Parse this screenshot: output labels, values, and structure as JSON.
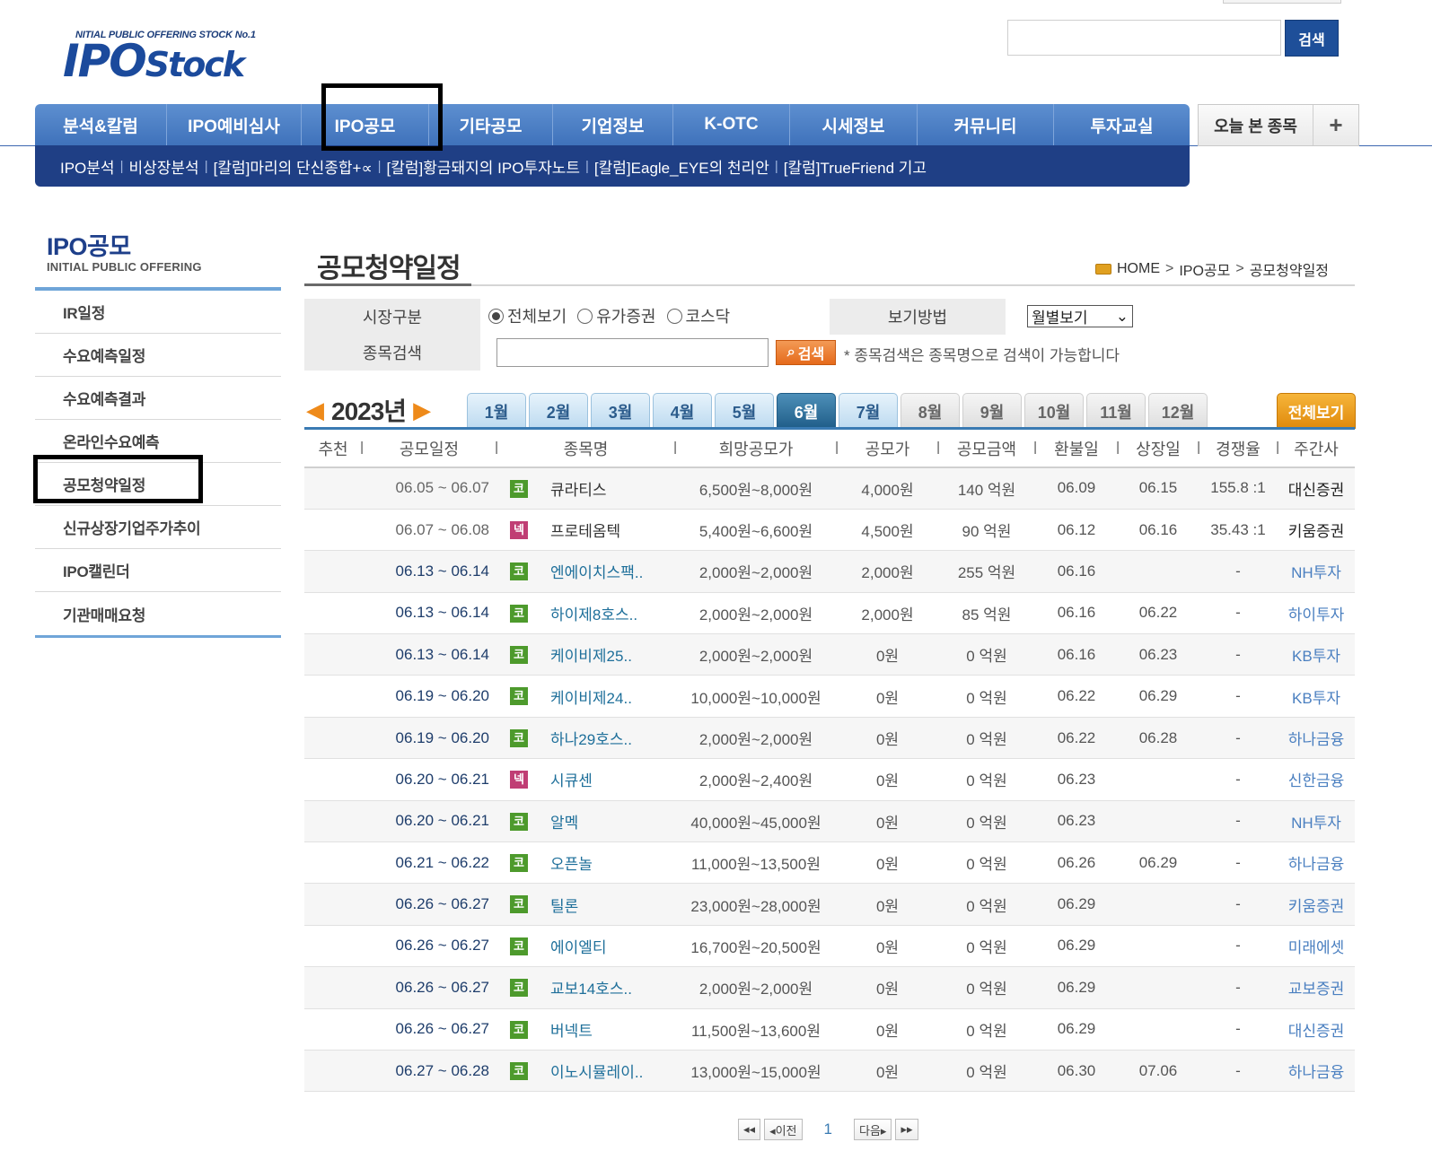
{
  "header": {
    "slogan": "NITIAL PUBLIC OFFERING STOCK No.1",
    "logo_main": "IPO",
    "logo_small": "Stock",
    "search_placeholder": "",
    "search_button": "검색"
  },
  "gnb": {
    "main": [
      "분석&칼럼",
      "IPO예비심사",
      "IPO공모",
      "기타공모",
      "기업정보",
      "K-OTC",
      "시세정보",
      "커뮤니티",
      "투자교실"
    ],
    "sub": [
      "IPO분석",
      "비상장분석",
      "[칼럼]마리의 단신종합+∝",
      "[칼럼]황금돼지의 IPO투자노트",
      "[칼럼]Eagle_EYE의 천리안",
      "[칼럼]TrueFriend 기고"
    ],
    "today_label": "오늘 본 종목",
    "plus_icon": "+"
  },
  "lnb": {
    "title": "IPO공모",
    "subtitle": "INITIAL PUBLIC OFFERING",
    "items": [
      "IR일정",
      "수요예측일정",
      "수요예측결과",
      "온라인수요예측",
      "공모청약일정",
      "신규상장기업주가추이",
      "IPO캘린더",
      "기관매매요청"
    ]
  },
  "content": {
    "title": "공모청약일정",
    "breadcrumb": [
      "HOME",
      "IPO공모",
      "공모청약일정"
    ]
  },
  "filter": {
    "market_label": "시장구분",
    "market_options": [
      "전체보기",
      "유가증권",
      "코스닥"
    ],
    "market_selected": "전체보기",
    "view_label": "보기방법",
    "view_value": "월별보기",
    "stock_label": "종목검색",
    "stock_value": "",
    "stock_button": "검색",
    "note": "* 종목검색은 종목명으로 검색이 가능합니다"
  },
  "calendar": {
    "year": "2023년",
    "months": [
      "1월",
      "2월",
      "3월",
      "4월",
      "5월",
      "6월",
      "7월",
      "8월",
      "9월",
      "10월",
      "11월",
      "12월"
    ],
    "active_month": "6월",
    "all_button": "전체보기"
  },
  "table": {
    "headers": [
      "추천",
      "공모일정",
      "종목명",
      "희망공모가",
      "공모가",
      "공모금액",
      "환불일",
      "상장일",
      "경쟁율",
      "주간사"
    ],
    "rows": [
      {
        "date": "06.05 ~ 06.07",
        "mark": "코",
        "name": "큐라티스",
        "hope": "6,500원~8,000원",
        "price": "4,000원",
        "amount": "140 억원",
        "refund": "06.09",
        "listing": "06.15",
        "rate": "155.8 :1",
        "lead": "대신증권"
      },
      {
        "date": "06.07 ~ 06.08",
        "mark": "넥",
        "name": "프로테옴텍",
        "hope": "5,400원~6,600원",
        "price": "4,500원",
        "amount": "90 억원",
        "refund": "06.12",
        "listing": "06.16",
        "rate": "35.43 :1",
        "lead": "키움증권"
      },
      {
        "date": "06.13 ~ 06.14",
        "mark": "코",
        "name": "엔에이치스팩..",
        "hope": "2,000원~2,000원",
        "price": "2,000원",
        "amount": "255 억원",
        "refund": "06.16",
        "listing": "",
        "rate": "-",
        "lead": "NH투자"
      },
      {
        "date": "06.13 ~ 06.14",
        "mark": "코",
        "name": "하이제8호스..",
        "hope": "2,000원~2,000원",
        "price": "2,000원",
        "amount": "85 억원",
        "refund": "06.16",
        "listing": "06.22",
        "rate": "-",
        "lead": "하이투자"
      },
      {
        "date": "06.13 ~ 06.14",
        "mark": "코",
        "name": "케이비제25..",
        "hope": "2,000원~2,000원",
        "price": "0원",
        "amount": "0 억원",
        "refund": "06.16",
        "listing": "06.23",
        "rate": "-",
        "lead": "KB투자"
      },
      {
        "date": "06.19 ~ 06.20",
        "mark": "코",
        "name": "케이비제24..",
        "hope": "10,000원~10,000원",
        "price": "0원",
        "amount": "0 억원",
        "refund": "06.22",
        "listing": "06.29",
        "rate": "-",
        "lead": "KB투자"
      },
      {
        "date": "06.19 ~ 06.20",
        "mark": "코",
        "name": "하나29호스..",
        "hope": "2,000원~2,000원",
        "price": "0원",
        "amount": "0 억원",
        "refund": "06.22",
        "listing": "06.28",
        "rate": "-",
        "lead": "하나금융"
      },
      {
        "date": "06.20 ~ 06.21",
        "mark": "넥",
        "name": "시큐센",
        "hope": "2,000원~2,400원",
        "price": "0원",
        "amount": "0 억원",
        "refund": "06.23",
        "listing": "",
        "rate": "-",
        "lead": "신한금융"
      },
      {
        "date": "06.20 ~ 06.21",
        "mark": "코",
        "name": "알멕",
        "hope": "40,000원~45,000원",
        "price": "0원",
        "amount": "0 억원",
        "refund": "06.23",
        "listing": "",
        "rate": "-",
        "lead": "NH투자"
      },
      {
        "date": "06.21 ~ 06.22",
        "mark": "코",
        "name": "오픈놀",
        "hope": "11,000원~13,500원",
        "price": "0원",
        "amount": "0 억원",
        "refund": "06.26",
        "listing": "06.29",
        "rate": "-",
        "lead": "하나금융"
      },
      {
        "date": "06.26 ~ 06.27",
        "mark": "코",
        "name": "틸론",
        "hope": "23,000원~28,000원",
        "price": "0원",
        "amount": "0 억원",
        "refund": "06.29",
        "listing": "",
        "rate": "-",
        "lead": "키움증권"
      },
      {
        "date": "06.26 ~ 06.27",
        "mark": "코",
        "name": "에이엘티",
        "hope": "16,700원~20,500원",
        "price": "0원",
        "amount": "0 억원",
        "refund": "06.29",
        "listing": "",
        "rate": "-",
        "lead": "미래에셋"
      },
      {
        "date": "06.26 ~ 06.27",
        "mark": "코",
        "name": "교보14호스..",
        "hope": "2,000원~2,000원",
        "price": "0원",
        "amount": "0 억원",
        "refund": "06.29",
        "listing": "",
        "rate": "-",
        "lead": "교보증권"
      },
      {
        "date": "06.26 ~ 06.27",
        "mark": "코",
        "name": "버넥트",
        "hope": "11,500원~13,600원",
        "price": "0원",
        "amount": "0 억원",
        "refund": "06.29",
        "listing": "",
        "rate": "-",
        "lead": "대신증권"
      },
      {
        "date": "06.27 ~ 06.28",
        "mark": "코",
        "name": "이노시뮬레이..",
        "hope": "13,000원~15,000원",
        "price": "0원",
        "amount": "0 억원",
        "refund": "06.30",
        "listing": "07.06",
        "rate": "-",
        "lead": "하나금융"
      }
    ]
  },
  "paging": {
    "first": "◂◂",
    "prev": "◂이전",
    "current": "1",
    "next": "다음▸",
    "last": "▸▸"
  },
  "colors": {
    "brand_blue": "#1e4f99",
    "nav_blue": "#4a7fc4",
    "sub_nav": "#1f3f85",
    "orange": "#e56a1b",
    "kospi_mark": "#4d9a2c",
    "kosdaq_mark": "#c03e74"
  }
}
